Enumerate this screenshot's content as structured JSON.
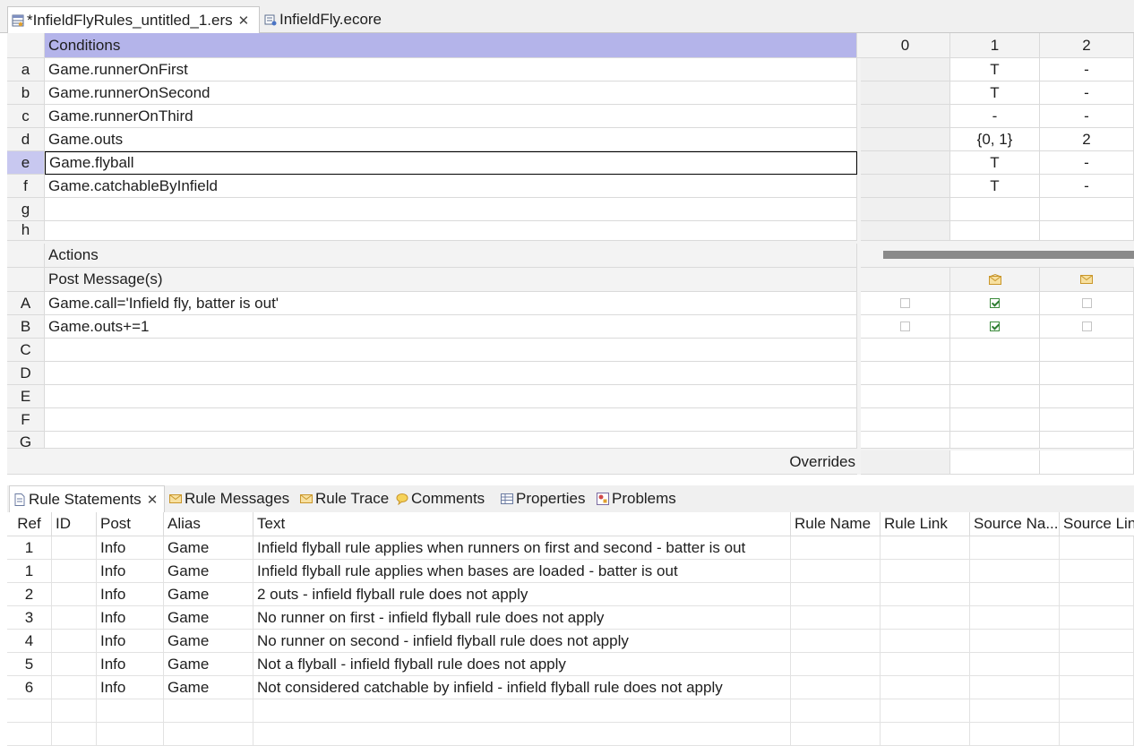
{
  "editor_tabs": [
    {
      "label": "*InfieldFlyRules_untitled_1.ers",
      "icon": "rulesheet-icon",
      "active": true
    },
    {
      "label": "InfieldFly.ecore",
      "icon": "ecore-icon",
      "active": false
    }
  ],
  "conditions": {
    "header": "Conditions",
    "column_headers": [
      "0",
      "1",
      "2"
    ],
    "rows": [
      {
        "id": "a",
        "text": "Game.runnerOnFirst",
        "values": [
          "",
          "T",
          "-"
        ]
      },
      {
        "id": "b",
        "text": "Game.runnerOnSecond",
        "values": [
          "",
          "T",
          "-"
        ]
      },
      {
        "id": "c",
        "text": "Game.runnerOnThird",
        "values": [
          "",
          "-",
          "-"
        ]
      },
      {
        "id": "d",
        "text": "Game.outs",
        "values": [
          "",
          "{0, 1}",
          "2"
        ]
      },
      {
        "id": "e",
        "text": "Game.flyball",
        "values": [
          "",
          "T",
          "-"
        ]
      },
      {
        "id": "f",
        "text": "Game.catchableByInfield",
        "values": [
          "",
          "T",
          "-"
        ]
      },
      {
        "id": "g",
        "text": "",
        "values": [
          "",
          "",
          ""
        ]
      },
      {
        "id": "h",
        "text": "",
        "values": [
          "",
          "",
          ""
        ]
      }
    ]
  },
  "actions": {
    "header": "Actions",
    "post_messages_label": "Post Message(s)",
    "rows": [
      {
        "id": "A",
        "text": "Game.call='Infield fly, batter is out'",
        "checks": [
          false,
          true,
          false
        ]
      },
      {
        "id": "B",
        "text": "Game.outs+=1",
        "checks": [
          false,
          true,
          false
        ]
      },
      {
        "id": "C",
        "text": "",
        "checks": []
      },
      {
        "id": "D",
        "text": "",
        "checks": []
      },
      {
        "id": "E",
        "text": "",
        "checks": []
      },
      {
        "id": "F",
        "text": "",
        "checks": []
      },
      {
        "id": "G",
        "text": "",
        "checks": []
      }
    ],
    "overrides_label": "Overrides"
  },
  "view_tabs": [
    {
      "label": "Rule Statements",
      "icon": "document-icon",
      "active": true
    },
    {
      "label": "Rule Messages",
      "icon": "envelope-icon",
      "active": false
    },
    {
      "label": "Rule Trace",
      "icon": "envelope-icon",
      "active": false
    },
    {
      "label": "Comments",
      "icon": "comment-icon",
      "active": false
    },
    {
      "label": "Properties",
      "icon": "properties-icon",
      "active": false
    },
    {
      "label": "Problems",
      "icon": "problems-icon",
      "active": false
    }
  ],
  "rule_statements": {
    "columns": [
      "Ref",
      "ID",
      "Post",
      "Alias",
      "Text",
      "Rule Name",
      "Rule Link",
      "Source Na...",
      "Source Lin"
    ],
    "rows": [
      [
        "1",
        "",
        "Info",
        "Game",
        "Infield flyball rule applies when runners on first and second - batter is out",
        "",
        "",
        "",
        ""
      ],
      [
        "1",
        "",
        "Info",
        "Game",
        "Infield flyball rule applies when bases are loaded - batter is out",
        "",
        "",
        "",
        ""
      ],
      [
        "2",
        "",
        "Info",
        "Game",
        "2 outs - infield flyball rule does not apply",
        "",
        "",
        "",
        ""
      ],
      [
        "3",
        "",
        "Info",
        "Game",
        "No runner on first - infield flyball rule does not apply",
        "",
        "",
        "",
        ""
      ],
      [
        "4",
        "",
        "Info",
        "Game",
        "No runner on second - infield flyball rule does not apply",
        "",
        "",
        "",
        ""
      ],
      [
        "5",
        "",
        "Info",
        "Game",
        "Not a flyball - infield flyball rule does not apply",
        "",
        "",
        "",
        ""
      ],
      [
        "6",
        "",
        "Info",
        "Game",
        "Not considered catchable by infield - infield flyball rule does not apply",
        "",
        "",
        "",
        ""
      ]
    ]
  },
  "colors": {
    "conditions_header": "#b4b4ea",
    "selected_row": "#c8c8f0",
    "envelope": "#e2b84a",
    "check": "#2e7d32"
  }
}
